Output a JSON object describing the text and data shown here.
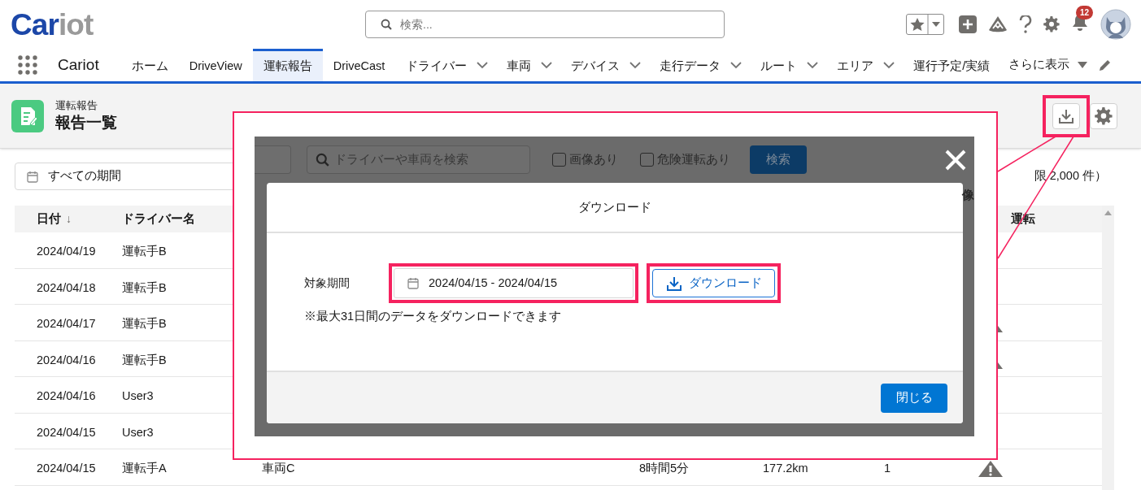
{
  "header": {
    "logo_parts": [
      "Car",
      "iot"
    ],
    "search": {
      "placeholder": "検索..."
    },
    "notification_count": "12"
  },
  "nav": {
    "app_name": "Cariot",
    "tabs": [
      {
        "label": "ホーム",
        "selected": false,
        "dropdown": false
      },
      {
        "label": "DriveView",
        "selected": false,
        "dropdown": false
      },
      {
        "label": "運転報告",
        "selected": true,
        "dropdown": false
      },
      {
        "label": "DriveCast",
        "selected": false,
        "dropdown": false
      },
      {
        "label": "ドライバー",
        "selected": false,
        "dropdown": true
      },
      {
        "label": "車両",
        "selected": false,
        "dropdown": true
      },
      {
        "label": "デバイス",
        "selected": false,
        "dropdown": true
      },
      {
        "label": "走行データ",
        "selected": false,
        "dropdown": true
      },
      {
        "label": "ルート",
        "selected": false,
        "dropdown": true
      },
      {
        "label": "エリア",
        "selected": false,
        "dropdown": true
      },
      {
        "label": "運行予定/実績",
        "selected": false,
        "dropdown": false
      }
    ],
    "more_label": "さらに表示"
  },
  "page_header": {
    "object_label": "運転報告",
    "title": "報告一覧"
  },
  "filter": {
    "date_range": "すべての期間"
  },
  "record_limit_text": "限 2,000 件）",
  "table": {
    "columns": [
      {
        "label": "日付",
        "kind": "date",
        "sort_indicator": "↓"
      },
      {
        "label": "ドライバー名",
        "kind": "driver"
      },
      {
        "label": "運転",
        "kind": "danger"
      }
    ],
    "rows": [
      {
        "date": "2024/04/19",
        "driver": "運転手B",
        "danger": false
      },
      {
        "date": "2024/04/18",
        "driver": "運転手B",
        "danger": false
      },
      {
        "date": "2024/04/17",
        "driver": "運転手B",
        "danger": true
      },
      {
        "date": "2024/04/16",
        "driver": "運転手B",
        "danger": true
      },
      {
        "date": "2024/04/16",
        "driver": "User3",
        "danger": false
      },
      {
        "date": "2024/04/15",
        "driver": "User3",
        "danger": false
      },
      {
        "date": "2024/04/15",
        "driver": "運転手A",
        "vehicle": "車両C",
        "duration": "8時間5分",
        "distance": "177.2km",
        "count": "1",
        "danger": true
      }
    ]
  },
  "callout": {
    "toolbar": {
      "search_placeholder": "ドライバーや車両を検索",
      "checkboxes": [
        {
          "label": "画像あり",
          "checked": false
        },
        {
          "label": "危険運転あり",
          "checked": false
        }
      ],
      "search_button": "検索"
    },
    "column_fragment": "像",
    "modal": {
      "title": "ダウンロード",
      "period_label": "対象期間",
      "period_value": "2024/04/15 - 2024/04/15",
      "download_button": "ダウンロード",
      "note": "※最大31日間のデータをダウンロードできます",
      "close_button": "閉じる"
    }
  }
}
